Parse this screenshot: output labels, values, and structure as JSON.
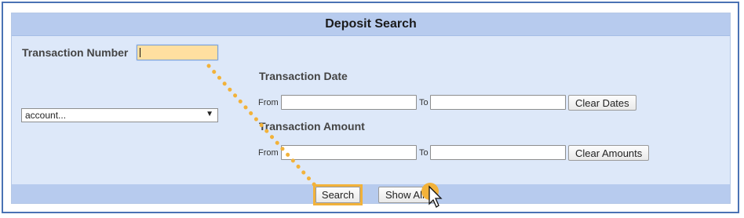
{
  "panel": {
    "title": "Deposit Search"
  },
  "transaction_number": {
    "label": "Transaction Number",
    "value": ""
  },
  "account_select": {
    "selected": "account..."
  },
  "transaction_date": {
    "heading": "Transaction Date",
    "from_label": "From",
    "to_label": "To",
    "from_value": "",
    "to_value": "",
    "clear_label": "Clear Dates"
  },
  "transaction_amount": {
    "heading": "Transaction Amount",
    "from_label": "From",
    "to_label": "To",
    "from_value": "",
    "to_value": "",
    "clear_label": "Clear Amounts"
  },
  "actions": {
    "search_label": "Search",
    "show_all_label": "Show All"
  },
  "colors": {
    "accent_highlight": "#f2b23a",
    "header_bar": "#b7cbee",
    "panel_bg": "#dde8f9",
    "focused_input": "#ffdfa0"
  },
  "icons": [
    "dropdown-arrow-icon",
    "mouse-cursor-icon"
  ]
}
